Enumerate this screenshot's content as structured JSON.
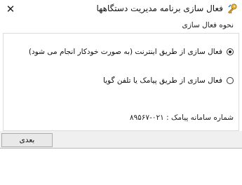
{
  "window": {
    "title": "فعال سازی برنامه مدیریت دستگاهها",
    "close_icon": "close-icon",
    "app_icon": "key-icon"
  },
  "section": {
    "subtitle": "نحوه فعال سازی"
  },
  "options": {
    "internet": {
      "label": "فعال سازی از طریق اینترنت (به صورت خودکار انجام می شود)",
      "checked": true
    },
    "sms": {
      "label": "فعال سازی از طریق پیامک یا تلفن گویا",
      "checked": false
    }
  },
  "sms_info": {
    "text": "شماره سامانه پیامک : ۰۲۱-۸۹۵۶۷"
  },
  "footer": {
    "next_label": "بعدی"
  }
}
